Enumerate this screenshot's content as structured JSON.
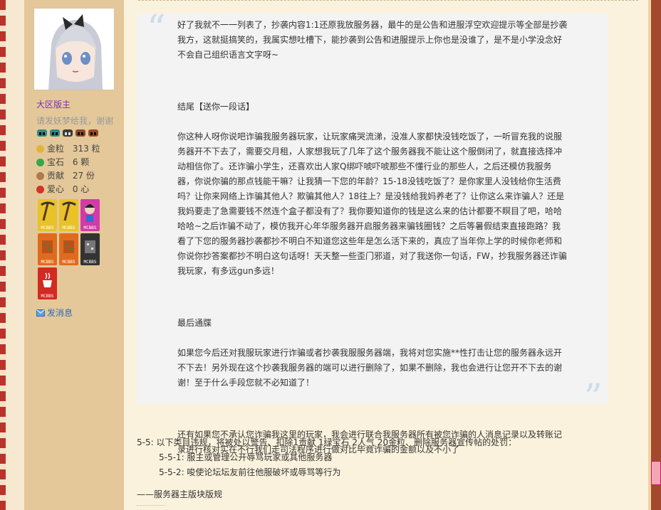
{
  "sidebar": {
    "group_title": "大区版主",
    "user_note": "请发妖梦给我，谢谢",
    "stats": [
      {
        "icon": "gold-coin-icon",
        "label": "金粒",
        "value": "313 粒",
        "color": "#e2b33a"
      },
      {
        "icon": "green-gem-icon",
        "label": "宝石",
        "value": "6 颗",
        "color": "#39a64a"
      },
      {
        "icon": "contribution-icon",
        "label": "贡献",
        "value": "27 份",
        "color": "#b07a4a"
      },
      {
        "icon": "heart-apple-icon",
        "label": "爱心",
        "value": "0 心",
        "color": "#d3332c"
      }
    ],
    "badge_label": "MCBBS",
    "message_label": "发消息"
  },
  "post": {
    "quote_paragraphs": [
      "好了我就不一一列表了，抄袭内容1:1还原我放服务器，最牛的是公告和进服浮空欢迎提示等全部是抄袭我方，这就挺搞笑的，我属实想吐槽下，能抄袭到公告和进服提示上你也是没谁了，是不是小学没念好不会自己组织语言文字呀~",
      "结尾【送你一段话】",
      "你这种人呀你说吧诈骗我服务器玩家，让玩家痛哭流涕，没准人家都快没钱吃饭了，一听冒充我的说服务器开不下去了，需要交月租，人家想我玩了几年了这个服务器我不能让这个服倒闭了，就直接选择冲动相信你了。还诈骗小学生，还喜欢出人家Q绑吓唬吓唬那些不懂行业的那些人，之后还模仿我服务器，你说你骗的那点钱能干嘛？让我猜一下您的年龄？15-18没钱吃饭了？是你家里人没钱给你生活费吗？让你来网络上诈骗其他人？欺骗其他人？18往上？是没钱给我妈养老了？让你这么来诈骗人？还是我妈要走了急需要钱不然连个盒子都没有了？我你要知道你的钱是这么来的估计都要不瞑目了吧，哈哈哈哈~之后诈骗不动了，模仿我开心年华服务器开启服务器来骗钱圈钱？之后等暑假结束直接跑路？我看了下您的服务器抄袭都抄不明白不知道您这些年是怎么活下来的，真应了当年你上学的时候你老师和你说你抄答案都抄不明白这句话呀！天天整一些歪门邪道，对了我送你一句话，FW，抄我服务器还诈骗我玩家，有多远gun多远！",
      "最后通牒",
      "如果您今后还对我服玩家进行诈骗或者抄袭我服服务器端，我将对您实施**性打击让您的服务器永远开不下去！另外现在这个抄袭我服务器的端可以进行删除了，如果不删除，我也会进行让您开不下去的谢谢！至于什么手段您就不必知道了！",
      "还有如果您不承认您诈骗我这里的玩家，我会进行联合我服务器所有被您诈骗的人消息记录以及转账记录进行核对实在不行我们走司法程序进行做对比毕竟诈骗的金额以及不小了"
    ],
    "rules_intro": "5-5: 以下类目违规，将被处以警告、扣除1贡献 1绿宝石 2人气 20金粒、删除服务器宣传帖的处罚：",
    "rules": [
      "5-5-1: 服主或管理公开辱骂玩家或其他服务器",
      "5-5-2: 唆使论坛坛友前往他服破坏或辱骂等行为"
    ],
    "signature": "——服务器主版块版规"
  }
}
